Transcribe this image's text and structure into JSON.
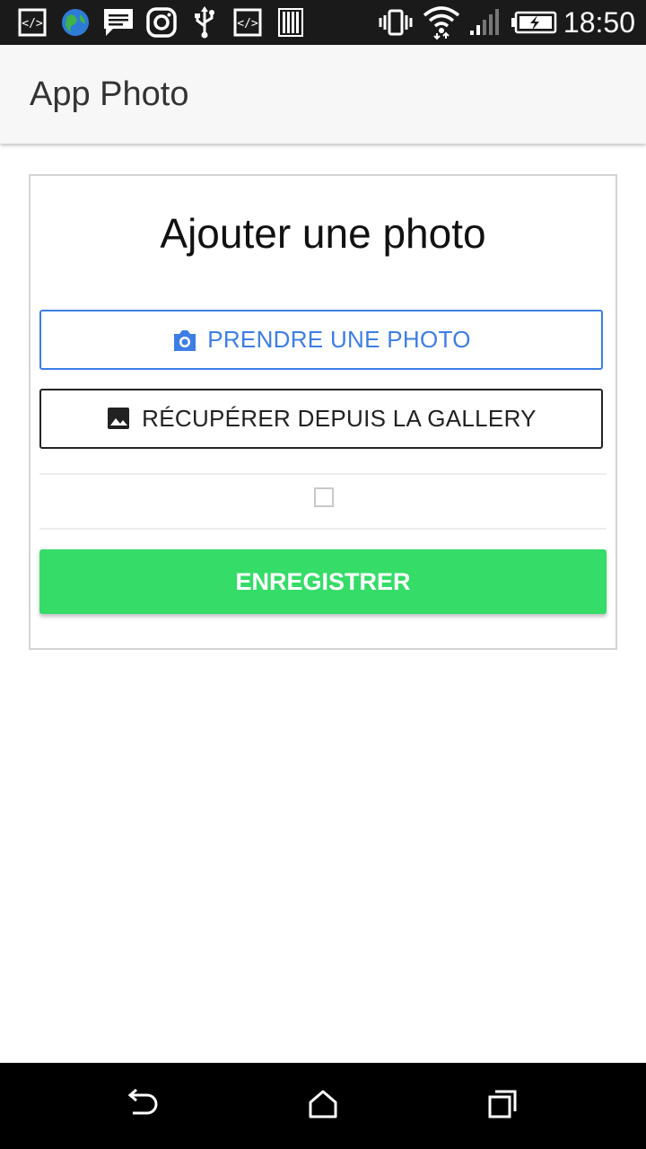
{
  "status_bar": {
    "time": "18:50",
    "icons_left": [
      "code-icon",
      "globe-icon",
      "message-icon",
      "instagram-icon",
      "usb-icon",
      "code-icon",
      "barcode-icon"
    ],
    "icons_right": [
      "vibrate-icon",
      "wifi-icon",
      "signal-icon",
      "battery-charging-icon"
    ]
  },
  "app_bar": {
    "title": "App Photo"
  },
  "card": {
    "title": "Ajouter une photo",
    "take_photo_label": "PRENDRE UNE PHOTO",
    "gallery_label": "RÉCUPÉRER DEPUIS LA GALLERY",
    "checkbox_checked": false,
    "save_label": "ENREGISTRER"
  },
  "colors": {
    "primary": "#3d7ee6",
    "save": "#35dc68",
    "status_bar": "#1a1a1a",
    "app_bar": "#f7f7f7"
  },
  "nav_bar": {
    "buttons": [
      "back-icon",
      "home-icon",
      "recent-apps-icon"
    ]
  }
}
